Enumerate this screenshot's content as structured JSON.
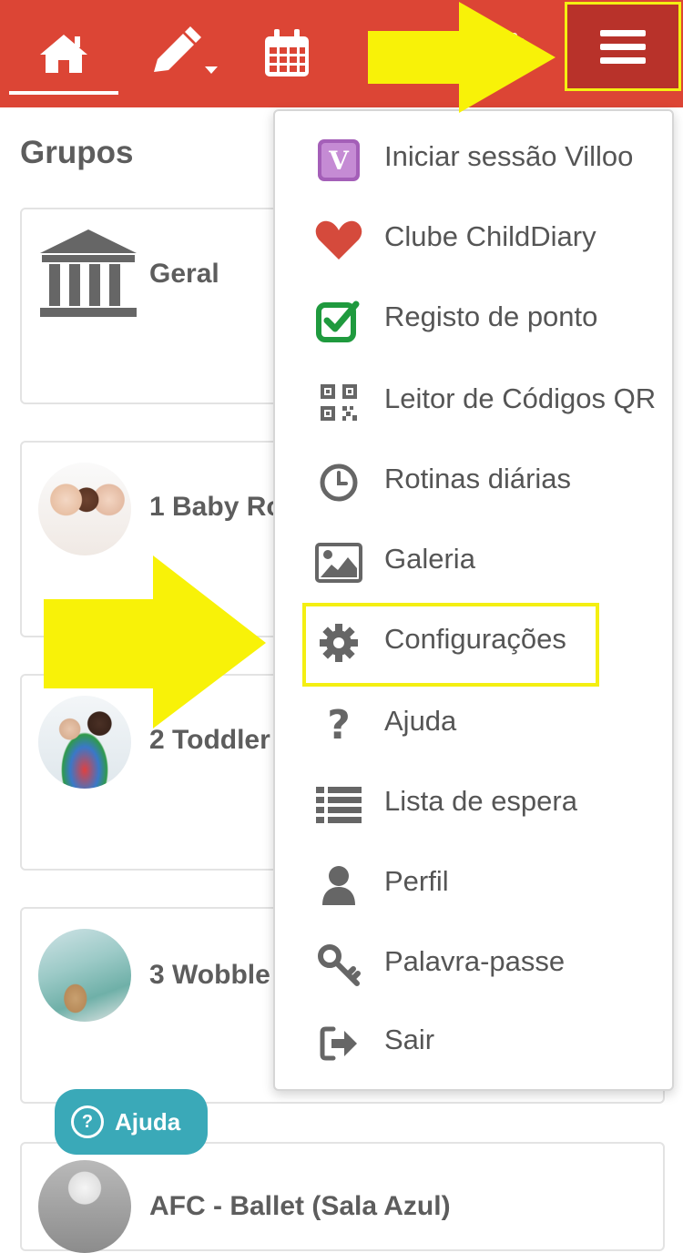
{
  "header": {
    "nav_icons": [
      "home-icon",
      "edit-icon",
      "calendar-icon",
      "clipboard-icon",
      "hamburger-menu-icon"
    ],
    "bar_color": "#dc4535",
    "active_tab": "home"
  },
  "main": {
    "title": "Grupos",
    "groups": [
      {
        "name": "Geral",
        "icon": "institution-icon"
      },
      {
        "name": "1 Baby Ro"
      },
      {
        "name": "2 Toddler"
      },
      {
        "name": "3 Wobble"
      },
      {
        "name": "AFC - Ballet (Sala Azul)"
      }
    ]
  },
  "help_button": {
    "label": "Ajuda",
    "color": "#3aa9b8"
  },
  "menu": {
    "items": [
      {
        "label": "Iniciar sessão Villoo",
        "icon": "villoo-icon"
      },
      {
        "label": "Clube ChildDiary",
        "icon": "heart-icon"
      },
      {
        "label": "Registo de ponto",
        "icon": "check-square-icon"
      },
      {
        "label": "Leitor de Códigos QR",
        "icon": "qr-code-icon"
      },
      {
        "label": "Rotinas diárias",
        "icon": "clock-icon"
      },
      {
        "label": "Galeria",
        "icon": "image-icon"
      },
      {
        "label": "Configurações",
        "icon": "gear-icon",
        "highlighted": true
      },
      {
        "label": "Ajuda",
        "icon": "question-icon"
      },
      {
        "label": "Lista de espera",
        "icon": "list-icon"
      },
      {
        "label": "Perfil",
        "icon": "user-icon"
      },
      {
        "label": "Palavra-passe",
        "icon": "key-icon"
      },
      {
        "label": "Sair",
        "icon": "sign-out-icon"
      }
    ],
    "villoo_letter": "V"
  },
  "annotation": {
    "highlight_color": "#f4ef12"
  }
}
